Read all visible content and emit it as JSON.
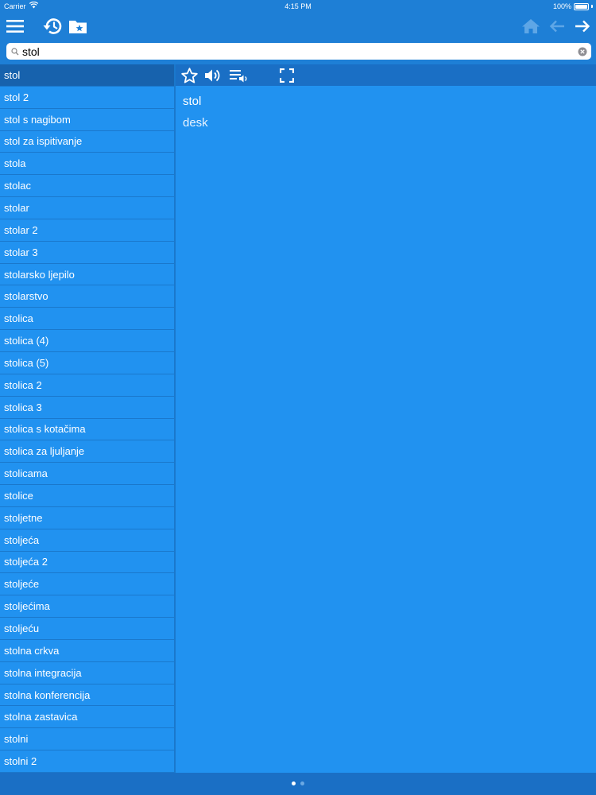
{
  "status": {
    "carrier": "Carrier",
    "time": "4:15 PM",
    "battery": "100%"
  },
  "colors": {
    "background": "#1e7fd6",
    "list": "#2192f0",
    "selected": "#1762ad",
    "toolbar_dark": "#1a6fc5"
  },
  "toolbar": {
    "icons": [
      "menu-icon",
      "history-icon",
      "favorites-folder-icon",
      "home-icon",
      "back-arrow-icon",
      "forward-arrow-icon"
    ]
  },
  "search": {
    "value": "stol",
    "placeholder": ""
  },
  "list": {
    "selected_index": 0,
    "items": [
      "stol",
      "stol 2",
      "stol s nagibom",
      "stol za ispitivanje",
      "stola",
      "stolac",
      "stolar",
      "stolar 2",
      "stolar 3",
      "stolarsko ljepilo",
      "stolarstvo",
      "stolica",
      "stolica (4)",
      "stolica (5)",
      "stolica 2",
      "stolica 3",
      "stolica s kotačima",
      "stolica za ljuljanje",
      "stolicama",
      "stolice",
      "stoljetne",
      "stoljeća",
      "stoljeća 2",
      "stoljeće",
      "stoljećima",
      "stoljeću",
      "stolna crkva",
      "stolna integracija",
      "stolna konferencija",
      "stolna zastavica",
      "stolni",
      "stolni 2"
    ]
  },
  "detail": {
    "headword": "stol",
    "translation": "desk",
    "icons": [
      "star-icon",
      "speaker-icon",
      "playlist-audio-icon",
      "fullscreen-icon"
    ]
  },
  "pager": {
    "pages": 2,
    "current": 0
  }
}
